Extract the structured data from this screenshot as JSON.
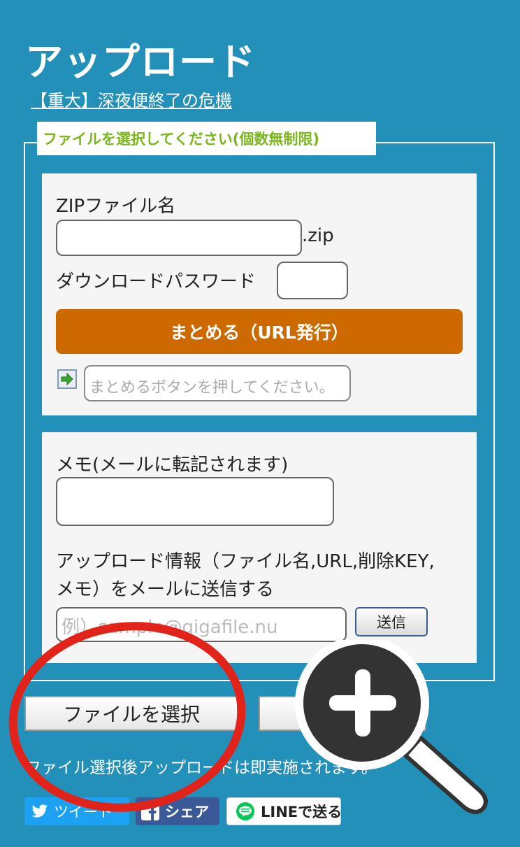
{
  "page": {
    "title": "アップロード",
    "notice_link": "【重大】深夜便終了の危機"
  },
  "fieldset": {
    "legend": "ファイルを選択してください(個数無制限)"
  },
  "zip_panel": {
    "zip_name_label": "ZIPファイル名",
    "zip_name_value": "",
    "zip_ext": ".zip",
    "password_label": "ダウンロードパスワード",
    "password_value": "",
    "merge_button": "まとめる（URL発行）",
    "url_placeholder": "まとめるボタンを押してください。"
  },
  "memo_panel": {
    "memo_label": "メモ(メールに転記されます)",
    "memo_value": "",
    "send_info_line1": "アップロード情報（ファイル名,URL,削除KEY,",
    "send_info_line2": "メモ）をメールに送信する",
    "email_placeholder": "例）sample@gigafile.nu",
    "send_button": "送信"
  },
  "actions": {
    "select_file_button": "ファイルを選択",
    "hint_text": "ファイル選択後アップロードは即実施されます。"
  },
  "share": {
    "tweet": "ツイート",
    "facebook": "シェア",
    "line": "LINEで送る"
  },
  "overlay": {
    "highlight_color": "#e2231a",
    "zoom_icon": "magnifier-plus-icon"
  },
  "colors": {
    "background": "#2290b9",
    "legend_text": "#7ab61c",
    "merge_button": "#cc6a00",
    "twitter": "#1da1f2",
    "facebook": "#3b5998",
    "line_green": "#06c755"
  }
}
